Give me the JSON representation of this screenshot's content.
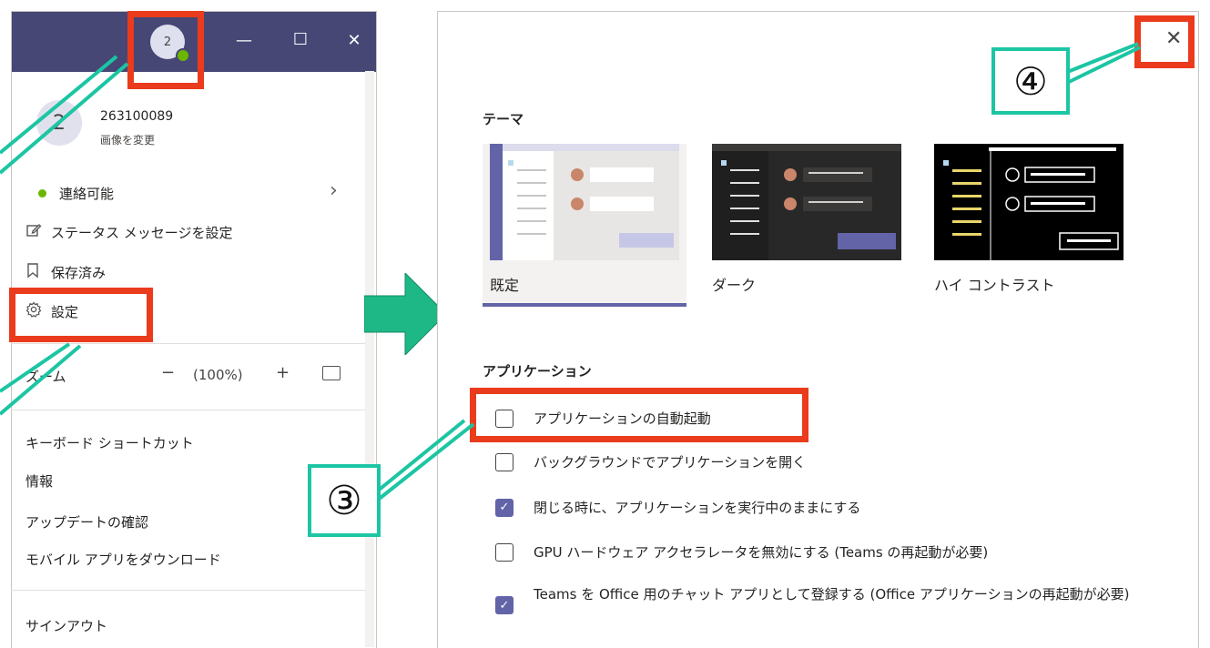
{
  "left_menu": {
    "titlebar": {
      "avatar_initial": "2",
      "minimize_glyph": "—",
      "maximize_glyph": "☐",
      "close_glyph": "✕",
      "background": "#464775"
    },
    "profile": {
      "avatar_initial": "2",
      "name": "263100089",
      "change_picture": "画像を変更"
    },
    "status": {
      "label": "連絡可能",
      "color": "#6bb700"
    },
    "status_message": {
      "label": "ステータス メッセージを設定",
      "icon": "edit-icon"
    },
    "saved": {
      "label": "保存済み",
      "icon": "bookmark-icon"
    },
    "settings": {
      "label": "設定",
      "icon": "gear-icon"
    },
    "zoom": {
      "label": "ズーム",
      "minus": "−",
      "value": "(100%)",
      "plus": "+"
    },
    "items": [
      {
        "label": "キーボード ショートカット"
      },
      {
        "label": "情報"
      },
      {
        "label": "アップデートの確認"
      },
      {
        "label": "モバイル アプリをダウンロード"
      }
    ],
    "sign_out": "サインアウト"
  },
  "settings_panel": {
    "close_glyph": "✕",
    "theme": {
      "heading": "テーマ",
      "options": [
        {
          "label": "既定",
          "selected": true
        },
        {
          "label": "ダーク",
          "selected": false
        },
        {
          "label": "ハイ コントラスト",
          "selected": false
        }
      ]
    },
    "application": {
      "heading": "アプリケーション",
      "options": [
        {
          "label": "アプリケーションの自動起動",
          "checked": false
        },
        {
          "label": "バックグラウンドでアプリケーションを開く",
          "checked": false
        },
        {
          "label": "閉じる時に、アプリケーションを実行中のままにする",
          "checked": true
        },
        {
          "label": "GPU ハードウェア アクセラレータを無効にする (Teams の再起動が必要)",
          "checked": false
        },
        {
          "label": "Teams を Office 用のチャット アプリとして登録する (Office アプリケーションの再起動が必要)",
          "checked": true
        }
      ]
    },
    "accent_color": "#6264a7"
  },
  "annotations": {
    "step3": "③",
    "step4": "④",
    "highlight_color": "#ea3b1c",
    "callout_color": "#1cc5a3",
    "arrow_color": "#1db886"
  }
}
